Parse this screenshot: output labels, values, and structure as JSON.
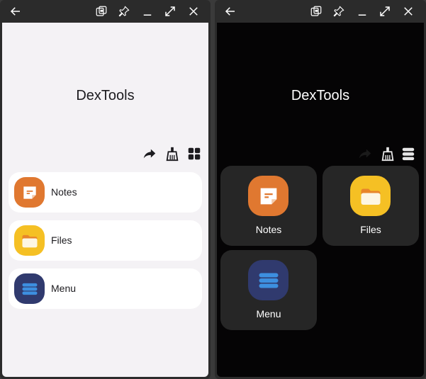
{
  "colors": {
    "titlebar_bg": "#2b2b2b",
    "light_bg": "#f4f2f5",
    "dark_bg": "#050405",
    "notes_accent": "#e07830",
    "files_accent": "#f5c024",
    "menu_accent": "#303a6e"
  },
  "left_window": {
    "titlebar_icons": [
      "back-arrow-icon",
      "picture-in-picture-icon",
      "pin-icon",
      "minimize-icon",
      "maximize-icon",
      "close-icon"
    ],
    "app_title": "DexTools",
    "actions": [
      "share-arrow-icon",
      "clean-broom-icon",
      "grid-view-icon"
    ],
    "items": [
      {
        "label": "Notes",
        "icon": "notes-icon"
      },
      {
        "label": "Files",
        "icon": "folder-icon"
      },
      {
        "label": "Menu",
        "icon": "menu-icon"
      }
    ]
  },
  "right_window": {
    "titlebar_icons": [
      "back-arrow-icon",
      "picture-in-picture-icon",
      "pin-icon",
      "minimize-icon",
      "maximize-icon",
      "close-icon"
    ],
    "app_title": "DexTools",
    "actions": [
      "share-arrow-icon",
      "clean-broom-icon",
      "list-view-icon"
    ],
    "items": [
      {
        "label": "Notes",
        "icon": "notes-icon"
      },
      {
        "label": "Files",
        "icon": "folder-icon"
      },
      {
        "label": "Menu",
        "icon": "menu-icon"
      }
    ]
  }
}
